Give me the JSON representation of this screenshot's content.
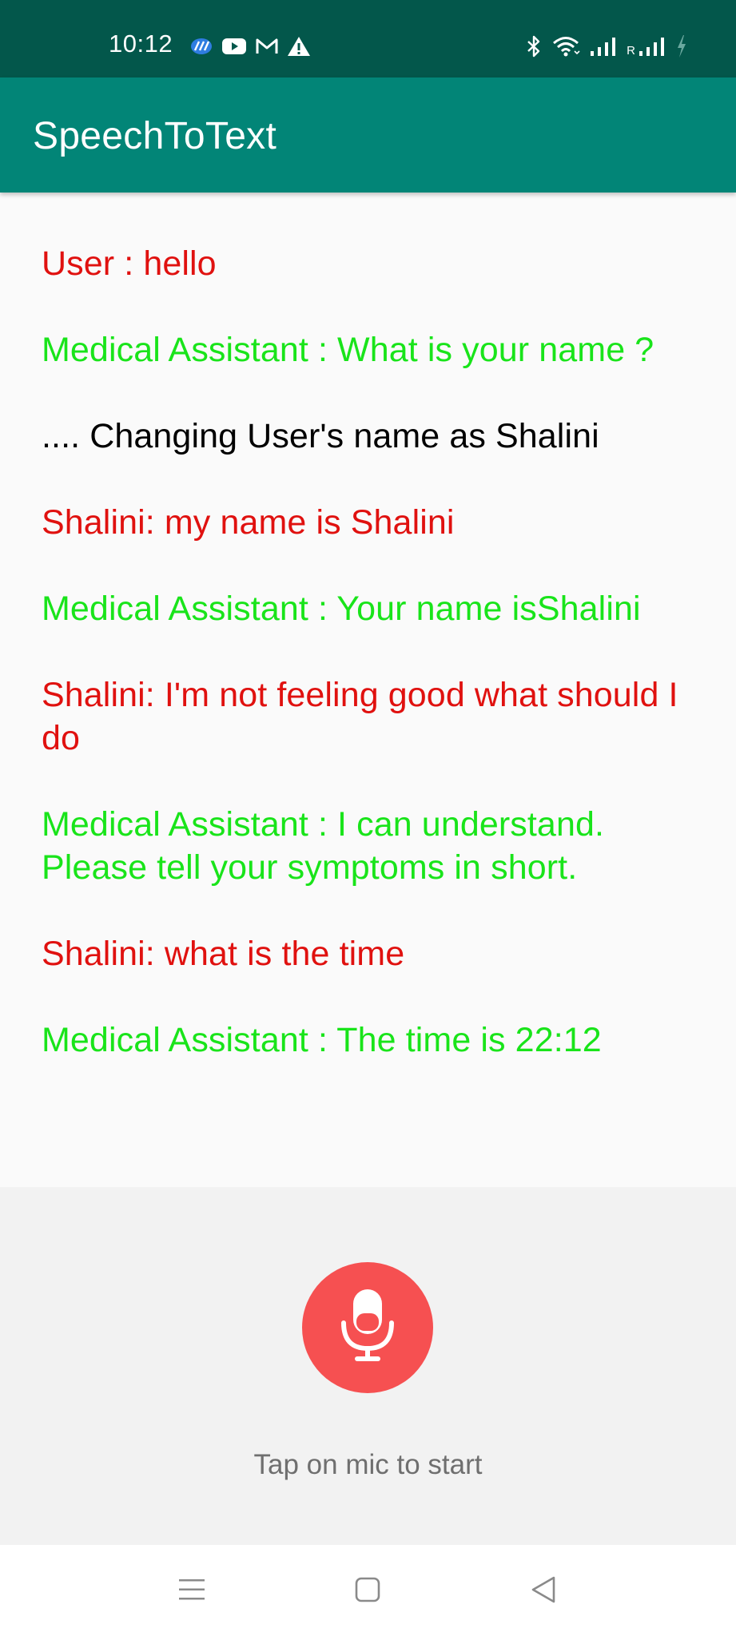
{
  "status_bar": {
    "time": "10:12",
    "left_icons": [
      "vpn-icon",
      "youtube-icon",
      "gmail-icon",
      "warning-icon"
    ],
    "right_icons": [
      "bluetooth-icon",
      "wifi-icon",
      "signal-icon",
      "roaming-signal-icon",
      "battery-charging-icon"
    ],
    "roaming_label": "R"
  },
  "app_bar": {
    "title": "SpeechToText"
  },
  "chat": {
    "messages": [
      {
        "role": "user",
        "text": "User : hello"
      },
      {
        "role": "assistant",
        "text": "Medical Assistant : What is your name ?"
      },
      {
        "role": "system",
        "text": ".... Changing User's name as Shalini"
      },
      {
        "role": "user",
        "text": "Shalini: my name is Shalini"
      },
      {
        "role": "assistant",
        "text": "Medical Assistant : Your name isShalini"
      },
      {
        "role": "user",
        "text": "Shalini: I'm not feeling good what should I do"
      },
      {
        "role": "assistant",
        "text": "Medical Assistant : I can understand. Please tell your symptoms in short."
      },
      {
        "role": "user",
        "text": "Shalini: what is the time"
      },
      {
        "role": "assistant",
        "text": "Medical Assistant : The time is 22:12"
      }
    ]
  },
  "controls": {
    "mic_icon": "microphone-icon",
    "hint": "Tap on mic to start"
  },
  "nav_bar": {
    "items": [
      "menu-icon",
      "home-icon",
      "back-icon"
    ]
  },
  "colors": {
    "status_bar": "#03574b",
    "app_bar": "#028577",
    "user_text": "#e0110f",
    "assistant_text": "#19e41a",
    "system_text": "#000000",
    "mic_button": "#f65051"
  }
}
